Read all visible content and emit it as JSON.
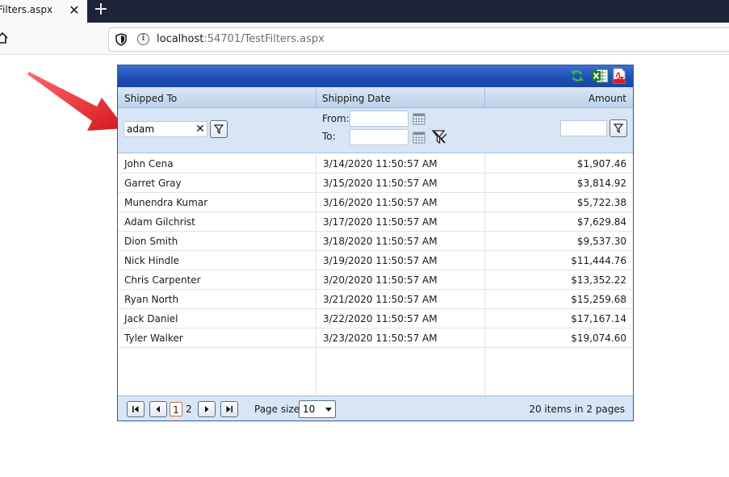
{
  "browser": {
    "tab_title": "Filters.aspx",
    "close_glyph": "✕",
    "new_tab_glyph": "+",
    "url_host": "localhost",
    "url_rest": ":54701/TestFilters.aspx",
    "icons": [
      "home-icon",
      "shield-icon",
      "info-icon"
    ]
  },
  "grid": {
    "toolbar_icons": [
      "refresh-icon",
      "excel-export-icon",
      "pdf-export-icon"
    ],
    "columns": [
      "Shipped To",
      "Shipping Date",
      "Amount"
    ],
    "filters": {
      "shipped_to_value": "adam",
      "clear_glyph": "✕",
      "from_label": "From:",
      "to_label": "To:",
      "from_value": "",
      "to_value": "",
      "amount_value": ""
    },
    "rows": [
      {
        "name": "John Cena",
        "date": "3/14/2020 11:50:57 AM",
        "amount": "$1,907.46"
      },
      {
        "name": "Garret Gray",
        "date": "3/15/2020 11:50:57 AM",
        "amount": "$3,814.92"
      },
      {
        "name": "Munendra Kumar",
        "date": "3/16/2020 11:50:57 AM",
        "amount": "$5,722.38"
      },
      {
        "name": "Adam Gilchrist",
        "date": "3/17/2020 11:50:57 AM",
        "amount": "$7,629.84"
      },
      {
        "name": "Dion Smith",
        "date": "3/18/2020 11:50:57 AM",
        "amount": "$9,537.30"
      },
      {
        "name": "Nick Hindle",
        "date": "3/19/2020 11:50:57 AM",
        "amount": "$11,444.76"
      },
      {
        "name": "Chris Carpenter",
        "date": "3/20/2020 11:50:57 AM",
        "amount": "$13,352.22"
      },
      {
        "name": "Ryan North",
        "date": "3/21/2020 11:50:57 AM",
        "amount": "$15,259.68"
      },
      {
        "name": "Jack Daniel",
        "date": "3/22/2020 11:50:57 AM",
        "amount": "$17,167.14"
      },
      {
        "name": "Tyler Walker",
        "date": "3/23/2020 11:50:57 AM",
        "amount": "$19,074.60"
      }
    ],
    "pager": {
      "pages": [
        "1",
        "2"
      ],
      "current_page": "1",
      "page_size_label": "Page size:",
      "page_size_value": "10",
      "info": "20 items in 2 pages"
    }
  },
  "colors": {
    "command_bar": "#1f4fb5",
    "header_bg": "#bcd2ec",
    "filter_bg": "#d7e5f5",
    "arrow": "#e3262b"
  }
}
